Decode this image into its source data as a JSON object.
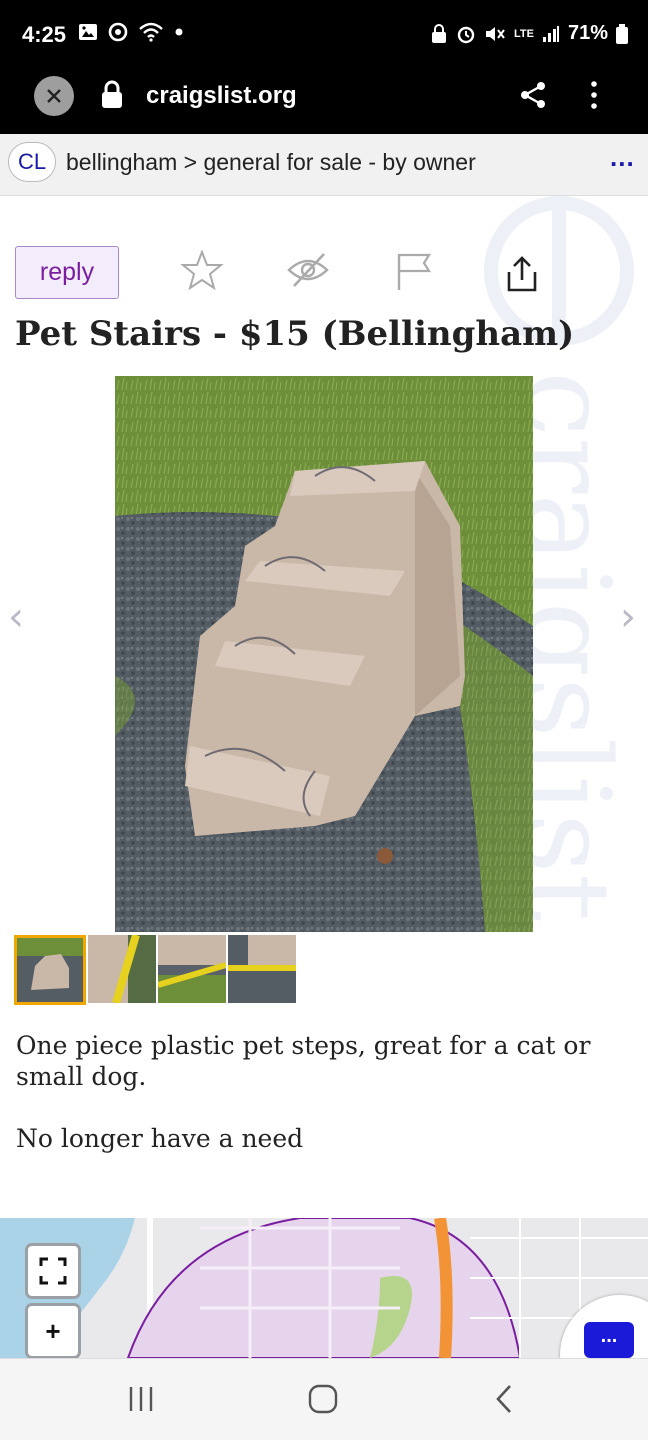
{
  "status_bar": {
    "time": "4:25",
    "battery": "71%",
    "network": "LTE"
  },
  "browser": {
    "url": "craigslist.org"
  },
  "breadcrumb": {
    "logo": "CL",
    "text": "bellingham > general for sale - by owner",
    "more": "..."
  },
  "actions": {
    "reply_label": "reply"
  },
  "post": {
    "title": "Pet Stairs - $15 (Bellingham)",
    "description": [
      "One piece plastic pet steps, great for a cat or small dog.",
      "No longer have a need"
    ]
  },
  "gallery": {
    "prev_arrow": "‹",
    "next_arrow": "›",
    "thumbnail_count": 4,
    "active_index": 0
  },
  "watermark": {
    "text": "craigslist"
  },
  "map": {
    "zoom_in_label": "+"
  },
  "chat": {
    "label": "..."
  },
  "colors": {
    "accent": "#7a1ea1",
    "brand_blue": "#1a1aa6",
    "active_thumb": "#f0a800"
  }
}
